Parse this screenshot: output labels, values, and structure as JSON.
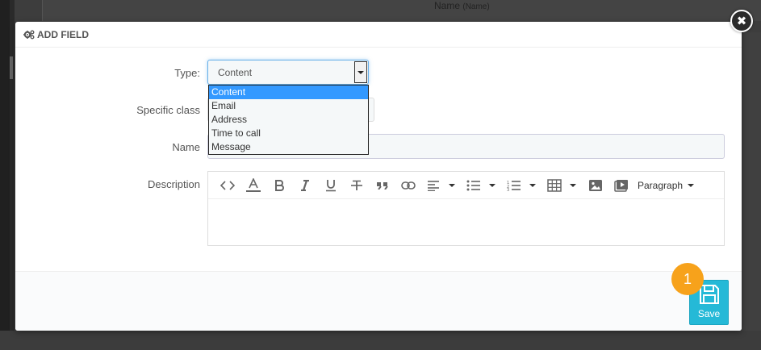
{
  "background": {
    "header_text": "Name",
    "header_small": "(Name)"
  },
  "modal": {
    "title": "ADD FIELD",
    "close_symbol": "✖",
    "accent_color": "#25b9d7"
  },
  "form": {
    "type_label": "Type:",
    "type_value": "Content",
    "type_options": [
      "Content",
      "Email",
      "Address",
      "Time to call",
      "Message"
    ],
    "class_label": "Specific class",
    "name_label": "Name",
    "description_label": "Description"
  },
  "editor": {
    "toolbar_icons": [
      "code-icon",
      "font-color-icon",
      "bold-icon",
      "italic-icon",
      "underline-icon",
      "strikethrough-icon",
      "quote-icon",
      "link-icon",
      "align-icon",
      "list-ul-icon",
      "list-ol-icon",
      "table-icon",
      "image-icon",
      "video-icon"
    ],
    "paragraph_label": "Paragraph"
  },
  "footer": {
    "save_label": "Save",
    "step_number": "1",
    "step_color": "#f7a21b"
  }
}
